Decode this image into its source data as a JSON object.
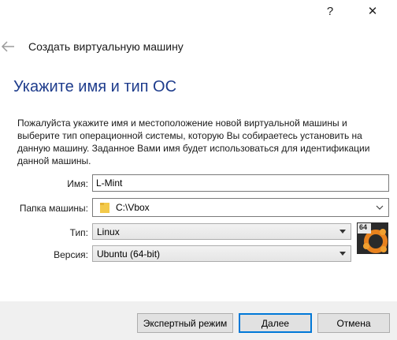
{
  "window": {
    "help_label": "?",
    "close_label": "✕"
  },
  "wizard": {
    "title": "Создать виртуальную машину"
  },
  "section": {
    "title": "Укажите имя и тип ОС"
  },
  "description": "Пожалуйста укажите имя и местоположение новой виртуальной машины и выберите тип операционной системы, которую Вы собираетесь установить на данную машину. Заданное Вами имя будет использоваться для идентификации данной машины.",
  "form": {
    "name_label": "Имя:",
    "name_value": "L-Mint",
    "folder_label": "Папка машины:",
    "folder_value": "C:\\Vbox",
    "type_label": "Тип:",
    "type_value": "Linux",
    "version_label": "Версия:",
    "version_value": "Ubuntu (64-bit)",
    "os_badge": "64"
  },
  "buttons": {
    "expert": "Экспертный режим",
    "next": "Далее",
    "cancel": "Отмена"
  },
  "icons": {
    "back": "back-arrow-icon",
    "folder": "folder-icon",
    "os": "ubuntu-os-icon"
  },
  "colors": {
    "section_title": "#1e3c8c",
    "footer_bg": "#f0f0f0",
    "default_button_border": "#0078d7"
  }
}
